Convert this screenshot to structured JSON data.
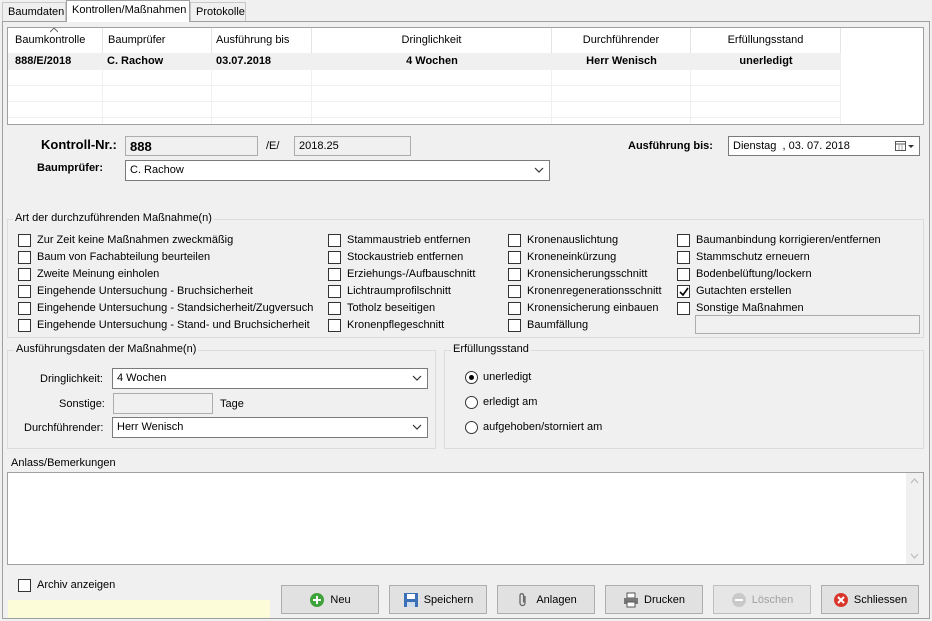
{
  "tabs": [
    "Baumdaten",
    "Kontrollen/Maßnahmen",
    "Protokolle"
  ],
  "grid": {
    "columns": [
      "Baumkontrolle",
      "Baumprüfer",
      "Ausführung bis",
      "Dringlichkeit",
      "Durchführender",
      "Erfüllungsstand"
    ],
    "rows": [
      [
        "888/E/2018",
        "C. Rachow",
        "03.07.2018",
        "4 Wochen",
        "Herr Wenisch",
        "unerledigt"
      ]
    ]
  },
  "header": {
    "kontroll_label": "Kontroll-Nr.:",
    "kontroll_nr": "888",
    "sep": "/E/",
    "kontroll_suffix": "2018.25",
    "ausfuehrung_label": "Ausführung bis:",
    "ausfuehrung_day": "Dienstag",
    "ausfuehrung_date": "03. 07. 2018",
    "baumpruefer_label": "Baumprüfer:",
    "baumpruefer_value": "C. Rachow"
  },
  "massnahmen": {
    "title": "Art der durchzuführenden Maßnahme(n)",
    "col1": [
      {
        "label": "Zur Zeit keine Maßnahmen zweckmäßig",
        "checked": false
      },
      {
        "label": "Baum von Fachabteilung beurteilen",
        "checked": false
      },
      {
        "label": "Zweite Meinung einholen",
        "checked": false
      },
      {
        "label": "Eingehende Untersuchung - Bruchsicherheit",
        "checked": false
      },
      {
        "label": "Eingehende Untersuchung - Standsicherheit/Zugversuch",
        "checked": false
      },
      {
        "label": "Eingehende Untersuchung - Stand- und Bruchsicherheit",
        "checked": false
      }
    ],
    "col2": [
      {
        "label": "Stammaustrieb entfernen",
        "checked": false
      },
      {
        "label": "Stockaustrieb entfernen",
        "checked": false
      },
      {
        "label": "Erziehungs-/Aufbauschnitt",
        "checked": false
      },
      {
        "label": "Lichtraumprofilschnitt",
        "checked": false
      },
      {
        "label": "Totholz beseitigen",
        "checked": false
      },
      {
        "label": "Kronenpflegeschnitt",
        "checked": false
      }
    ],
    "col3": [
      {
        "label": "Kronenauslichtung",
        "checked": false
      },
      {
        "label": "Kroneneinkürzung",
        "checked": false
      },
      {
        "label": "Kronensicherungsschnitt",
        "checked": false
      },
      {
        "label": "Kronenregenerationsschnitt",
        "checked": false
      },
      {
        "label": "Kronensicherung einbauen",
        "checked": false
      },
      {
        "label": "Baumfällung",
        "checked": false
      }
    ],
    "col4": [
      {
        "label": "Baumanbindung korrigieren/entfernen",
        "checked": false
      },
      {
        "label": "Stammschutz erneuern",
        "checked": false
      },
      {
        "label": "Bodenbelüftung/lockern",
        "checked": false
      },
      {
        "label": "Gutachten erstellen",
        "checked": true
      },
      {
        "label": "Sonstige Maßnahmen",
        "checked": false
      }
    ],
    "sonstige_value": ""
  },
  "ausfuehrungsdaten": {
    "title": "Ausführungsdaten der Maßnahme(n)",
    "dringlichkeit_label": "Dringlichkeit:",
    "dringlichkeit_value": "4 Wochen",
    "sonstige_label": "Sonstige:",
    "sonstige_value": "",
    "tage_label": "Tage",
    "durchfuehrender_label": "Durchführender:",
    "durchfuehrender_value": "Herr Wenisch"
  },
  "erfuellungsstand": {
    "title": "Erfüllungsstand",
    "options": [
      "unerledigt",
      "erledigt am",
      "aufgehoben/storniert am"
    ],
    "selected": "unerledigt"
  },
  "anlass": {
    "title": "Anlass/Bemerkungen",
    "value": ""
  },
  "footer": {
    "archiv_label": "Archiv anzeigen",
    "buttons": {
      "neu": "Neu",
      "speichern": "Speichern",
      "anlagen": "Anlagen",
      "drucken": "Drucken",
      "loeschen": "Löschen",
      "schliessen": "Schliessen"
    }
  },
  "colors": {
    "highlight_strip": "#fcfcd8",
    "row_selected": "#f0f0f0"
  }
}
